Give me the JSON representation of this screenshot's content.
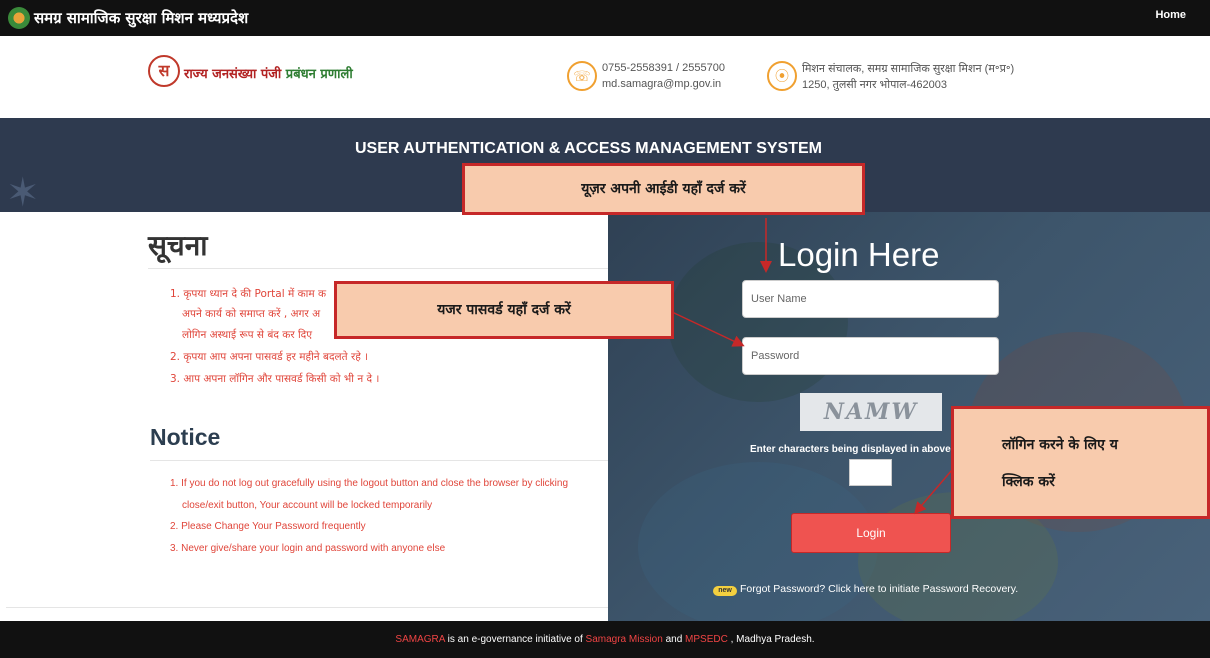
{
  "topbar": {
    "brand": "समग्र सामाजिक सुरक्षा मिशन मध्यप्रदेश",
    "home": "Home"
  },
  "header": {
    "emblem": "स",
    "title_red": "राज्य जनसंख्या पंजी ",
    "title_green": "प्रबंधन प्रणाली",
    "phone": "0755-2558391 / 2555700",
    "email": "md.samagra@mp.gov.in",
    "office_line1": "मिशन संचालक, समग्र सामाजिक सुरक्षा मिशन (म॰प्र॰)",
    "office_line2": "1250, तुलसी नगर भोपाल-462003",
    "phone_icon": "☏",
    "location_icon": "⦿"
  },
  "banner": {
    "title": "USER AUTHENTICATION & ACCESS MANAGEMENT SYSTEM"
  },
  "notice_hi": {
    "heading": "सूचना",
    "lines": [
      "1. कृपया ध्यान दे की Portal में काम क",
      "अपने कार्य को समाप्त करें , अगर अ",
      "लोगिन अस्थाई रूप से बंद कर दिए",
      "2. कृपया आप अपना पासवर्ड हर महीने बदलते रहे ।",
      "3. आप अपना लॉगिन और पासवर्ड किसी को भी न दे ।"
    ]
  },
  "notice_en": {
    "heading": "Notice",
    "lines": [
      "1. If you do not log out gracefully using the logout button and close the browser by clicking",
      "close/exit button, Your account will be locked temporarily",
      "2. Please Change Your Password frequently",
      "3. Never give/share your login and password with anyone else"
    ]
  },
  "login": {
    "heading": "Login Here",
    "username_placeholder": "User Name",
    "password_placeholder": "Password",
    "captcha_text": "NAMW",
    "captcha_label": "Enter characters being displayed in above",
    "button": "Login",
    "new_badge": "new",
    "forgot": "Forgot Password? Click here to initiate Password Recovery."
  },
  "callouts": {
    "user_id": "यूज़र अपनी आईडी यहाँ दर्ज करें",
    "password": "यजर पासवर्ड यहाँ दर्ज करें",
    "login_line1": "लॉगिन करने के लिए य",
    "login_line2": "क्लिक करें"
  },
  "footer": {
    "part1": "SAMAGRA",
    "part2": " is an e-governance initiative of ",
    "part3": "Samagra Mission",
    "part4": " and ",
    "part5": "MPSEDC",
    "part6": " , Madhya Pradesh."
  },
  "colors": {
    "accent_red": "#ef5350",
    "callout_fill": "#f8cbad",
    "banner": "#2e3a4f"
  }
}
